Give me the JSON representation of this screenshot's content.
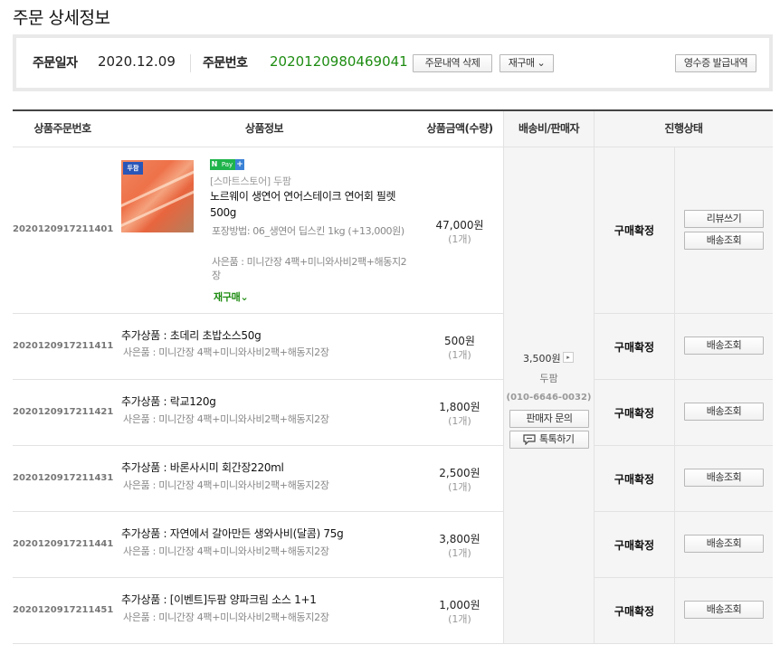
{
  "page": {
    "title": "주문 상세정보"
  },
  "order_summary": {
    "date_label": "주문일자",
    "date": "2020.12.09",
    "no_label": "주문번호",
    "no": "2020120980469041",
    "delete_button": "주문내역 삭제",
    "rebuy_button": "재구매 ⌄",
    "receipt_button": "영수증 발급내역"
  },
  "table": {
    "headers": [
      "상품주문번호",
      "상품정보",
      "상품금액(수량)",
      "배송비/판매자",
      "진행상태"
    ],
    "main_item": {
      "order_no": "2020120917211401",
      "pay_badge": {
        "n": "N",
        "pay": "Pay",
        "plus": "+"
      },
      "thumb_tag": "두팜",
      "seller_line": "[스마트스토어] 두팜",
      "name": "노르웨이 생연어 연어스테이크 연어회 필렛 500g",
      "option": "포장방법: 06_생연어 딥스킨 1kg (+13,000원)",
      "gift": "사은품 : 미니간장 4팩+미니와사비2팩+해동지2장",
      "rebuy_link": "재구매⌄",
      "price": "47,000원",
      "qty": "(1개)",
      "status": "구매확정",
      "review_button": "리뷰쓰기",
      "track_button": "배송조회"
    },
    "extra_items": [
      {
        "order_no": "2020120917211411",
        "name": "추가상품 : 초데리 초밥소스50g",
        "gift": "사은품 : 미니간장 4팩+미니와사비2팩+해동지2장",
        "price": "500원",
        "qty": "(1개)",
        "status": "구매확정",
        "track_button": "배송조회"
      },
      {
        "order_no": "2020120917211421",
        "name": "추가상품 : 락교120g",
        "gift": "사은품 : 미니간장 4팩+미니와사비2팩+해동지2장",
        "price": "1,800원",
        "qty": "(1개)",
        "status": "구매확정",
        "track_button": "배송조회"
      },
      {
        "order_no": "2020120917211431",
        "name": "추가상품 : 바론사시미 회간장220ml",
        "gift": "사은품 : 미니간장 4팩+미니와사비2팩+해동지2장",
        "price": "2,500원",
        "qty": "(1개)",
        "status": "구매확정",
        "track_button": "배송조회"
      },
      {
        "order_no": "2020120917211441",
        "name": "추가상품 : 자연에서 갈아만든 생와사비(달콤) 75g",
        "gift": "사은품 : 미니간장 4팩+미니와사비2팩+해동지2장",
        "price": "3,800원",
        "qty": "(1개)",
        "status": "구매확정",
        "track_button": "배송조회"
      },
      {
        "order_no": "2020120917211451",
        "name": "추가상품 : [이벤트]두팜 양파크림 소스 1+1",
        "gift": "사은품 : 미니간장 4팩+미니와사비2팩+해동지2장",
        "price": "1,000원",
        "qty": "(1개)",
        "status": "구매확정",
        "track_button": "배송조회"
      }
    ],
    "shipping": {
      "fee": "3,500원",
      "arrow": "▸",
      "seller": "두팜",
      "phone": "(010-6646-0032)",
      "inquiry_button": "판매자 문의",
      "talk_button": "톡톡하기"
    }
  },
  "colors": {
    "accent_green": "#1e8c12",
    "npay_green": "#1fb44b",
    "header_line": "#444444",
    "shade": "#f5f5f5"
  }
}
